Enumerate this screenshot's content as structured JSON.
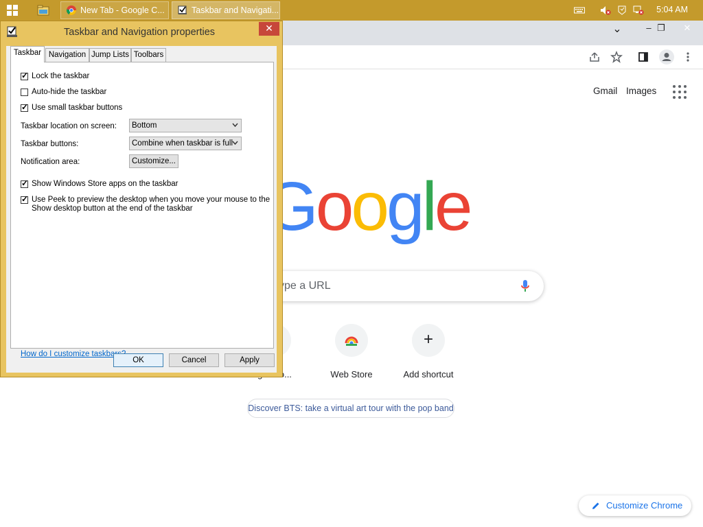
{
  "taskbar": {
    "buttons": [
      {
        "label": "New Tab - Google C..."
      },
      {
        "label": "Taskbar and Navigati..."
      }
    ],
    "clock": "5:04 AM"
  },
  "chrome": {
    "header_links": {
      "gmail": "Gmail",
      "images": "Images"
    },
    "search_placeholder": "ype a URL",
    "shortcuts": [
      {
        "label": "g Chro..."
      },
      {
        "label": "Web Store"
      },
      {
        "label": "Add shortcut"
      }
    ],
    "add_glyph": "+",
    "promo": "Discover BTS: take a virtual art tour with the pop band",
    "customize": "Customize Chrome",
    "window_controls": {
      "chevron": "⌄",
      "minimize": "–",
      "restore": "❐",
      "close": "✕"
    },
    "logo": [
      {
        "ch": "G",
        "color": "#4285f4"
      },
      {
        "ch": "o",
        "color": "#ea4335"
      },
      {
        "ch": "o",
        "color": "#fbbc05"
      },
      {
        "ch": "g",
        "color": "#4285f4"
      },
      {
        "ch": "l",
        "color": "#34a853"
      },
      {
        "ch": "e",
        "color": "#ea4335"
      }
    ]
  },
  "dialog": {
    "title": "Taskbar and Navigation properties",
    "close": "✕",
    "tabs": [
      {
        "label": "Taskbar"
      },
      {
        "label": "Navigation"
      },
      {
        "label": "Jump Lists"
      },
      {
        "label": "Toolbars"
      }
    ],
    "checkboxes": {
      "lock": {
        "label": "Lock the taskbar",
        "checked": true
      },
      "autohide": {
        "label": "Auto-hide the taskbar",
        "checked": false
      },
      "small": {
        "label": "Use small taskbar buttons",
        "checked": true
      },
      "store": {
        "label": "Show Windows Store apps on the taskbar",
        "checked": true
      },
      "peek_line1": "Use Peek to preview the desktop when you move your mouse to the",
      "peek_line2": "Show desktop button at the end of the taskbar"
    },
    "location": {
      "label": "Taskbar location on screen:",
      "value": "Bottom"
    },
    "tb_buttons": {
      "label": "Taskbar buttons:",
      "value": "Combine when taskbar is full"
    },
    "notification": {
      "label": "Notification area:",
      "button": "Customize..."
    },
    "help_link": "How do I customize taskbars?",
    "actions": {
      "ok": "OK",
      "cancel": "Cancel",
      "apply": "Apply"
    }
  },
  "colors": {
    "taskbar": "#c49a2c",
    "dialog_frame": "#e8c460",
    "close_button": "#c7473a",
    "link": "#0066cc"
  }
}
